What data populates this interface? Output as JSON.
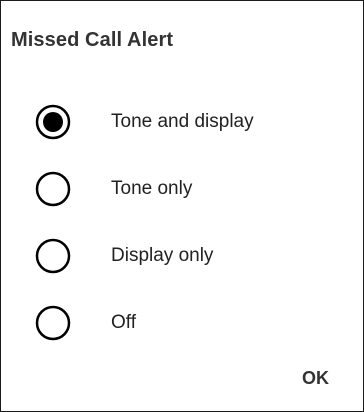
{
  "dialog": {
    "title": "Missed Call Alert",
    "options": [
      {
        "label": "Tone and display",
        "selected": true
      },
      {
        "label": "Tone only",
        "selected": false
      },
      {
        "label": "Display only",
        "selected": false
      },
      {
        "label": "Off",
        "selected": false
      }
    ],
    "ok_label": "OK"
  },
  "colors": {
    "text": "#222222",
    "title": "#333333",
    "radio": "#000000",
    "background": "#ffffff"
  }
}
